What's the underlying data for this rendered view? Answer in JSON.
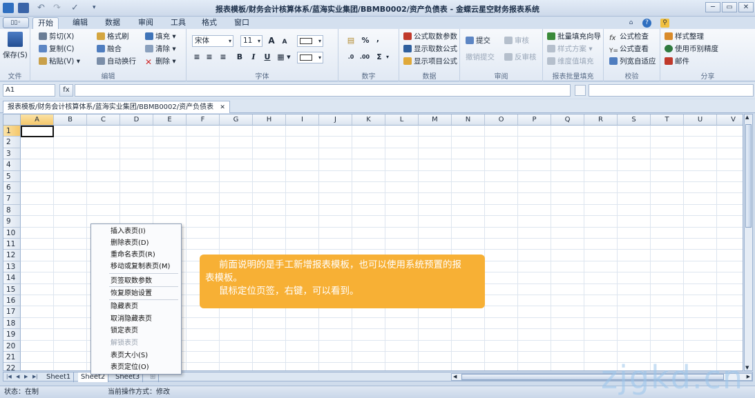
{
  "window": {
    "title": "报表模板/财务会计核算体系/蓝海实业集团/BBMB0002/资产负债表 - 金蝶云星空财务报表系统"
  },
  "window_controls": {
    "minimize": "─",
    "restore": "▭",
    "close": "✕"
  },
  "office_button": "▯▯◦",
  "tabs": [
    "开始",
    "编辑",
    "数据",
    "审阅",
    "工具",
    "格式",
    "窗口"
  ],
  "ribbon": {
    "file": {
      "save": "保存(S)",
      "label": "文件"
    },
    "edit": {
      "cut": "剪切(X)",
      "copy": "复制(C)",
      "paste": "粘贴(V)",
      "format_painter": "格式刷",
      "merge": "融合",
      "wrap": "自动换行",
      "fill": "填充",
      "clear": "清除",
      "delete": "删除",
      "label": "编辑"
    },
    "font": {
      "family": "宋体",
      "size": "11",
      "bold": "B",
      "italic": "I",
      "underline": "U",
      "grow": "A",
      "shrink": "A",
      "label": "字体"
    },
    "number": {
      "percent": "%",
      "comma": ",",
      "sum": "Σ",
      "label": "数字"
    },
    "data": {
      "formula_params": "公式取数参数",
      "show_formula": "显示取数公式",
      "show_items": "显示项目公式",
      "label": "数据"
    },
    "review": {
      "submit": "提交",
      "withdraw": "撤销提交",
      "approve": "审核",
      "unapprove": "反审核",
      "label": "审阅"
    },
    "batch": {
      "wizard": "批量填充向导",
      "style_scheme": "样式方案",
      "dim_fill": "维度值填充",
      "label": "报表批量填充"
    },
    "check": {
      "formula_check": "公式检查",
      "formula_view": "公式查看",
      "autofit": "列宽自适应",
      "label": "校验"
    },
    "share": {
      "style_org": "样式整理",
      "currency_precision": "使用币别精度",
      "mail": "邮件",
      "label": "分享"
    }
  },
  "formula_bar": {
    "cell": "A1",
    "fx": "fx"
  },
  "doc_tab": {
    "title": "报表模板/财务会计核算体系/蓝海实业集团/BBMB0002/资产负债表",
    "close": "✕"
  },
  "grid": {
    "columns": [
      "A",
      "B",
      "C",
      "D",
      "E",
      "F",
      "G",
      "H",
      "I",
      "J",
      "K",
      "L",
      "M",
      "N",
      "O",
      "P",
      "Q",
      "R",
      "S",
      "T",
      "U",
      "V"
    ],
    "rows": [
      "1",
      "2",
      "3",
      "4",
      "5",
      "6",
      "7",
      "8",
      "9",
      "10",
      "11",
      "12",
      "13",
      "14",
      "15",
      "16",
      "17",
      "18",
      "19",
      "20",
      "21",
      "22"
    ],
    "selected": "A1"
  },
  "sheets": [
    "Sheet1",
    "Sheet2",
    "Sheet3",
    "⊞"
  ],
  "context_menu": [
    {
      "label": "插入表页(I)",
      "disabled": false
    },
    {
      "label": "删除表页(D)",
      "disabled": false
    },
    {
      "label": "重命名表页(R)",
      "disabled": false
    },
    {
      "label": "移动或复制表页(M)",
      "disabled": false
    },
    {
      "label": "页签取数参数",
      "disabled": false
    },
    {
      "label": "恢复原始设置",
      "disabled": false
    },
    {
      "label": "隐藏表页",
      "disabled": false
    },
    {
      "label": "取消隐藏表页",
      "disabled": false
    },
    {
      "label": "锁定表页",
      "disabled": false
    },
    {
      "label": "解锁表页",
      "disabled": true
    },
    {
      "label": "表页大小(S)",
      "disabled": false
    },
    {
      "label": "表页定位(O)",
      "disabled": false
    }
  ],
  "callout": {
    "line1": "前面说明的是手工新增报表模板，也可以使用系统预置的报",
    "line2": "表模板。",
    "line3": "鼠标定位页签，右键，可以看到。"
  },
  "status": {
    "state": "状态：在制",
    "mode": "当前操作方式：修改"
  },
  "watermark": "zjgkd.cn",
  "colors": {
    "accent": "#f7b035",
    "ribbon": "#e1e9f4",
    "grid_line": "#dde5ef"
  }
}
